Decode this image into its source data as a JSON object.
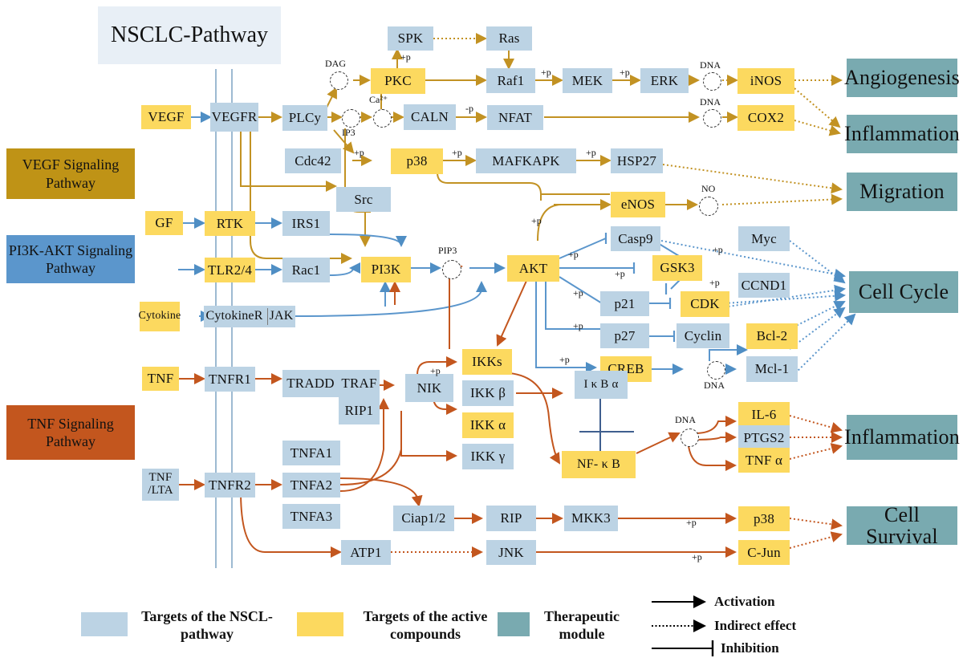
{
  "title": "NSCLC-Pathway",
  "colors": {
    "node_blue": "#bcd3e4",
    "node_yellow": "#fcd95f",
    "module_teal": "#79aab0",
    "vegf_pathway": "#bf9316",
    "pi3k_pathway": "#5b96cc",
    "tnf_pathway": "#c3561e",
    "title_bg": "#e8eff6",
    "edge_gold": "#c29223",
    "edge_blue": "#5b96cc",
    "edge_red": "#c3561e"
  },
  "pathway_labels": [
    {
      "id": "pw-vegf",
      "text": "VEGF Signaling Pathway",
      "color": "#bf9316"
    },
    {
      "id": "pw-pi3k",
      "text": "PI3K-AKT Signaling Pathway",
      "color": "#5b96cc"
    },
    {
      "id": "pw-tnf",
      "text": "TNF Signaling Pathway",
      "color": "#c3561e"
    }
  ],
  "nodes": {
    "vegf": "VEGF",
    "vegfr": "VEGFR",
    "plcy": "PLCy",
    "caln": "CALN",
    "nfat": "NFAT",
    "pkc": "PKC",
    "spk": "SPK",
    "ras": "Ras",
    "raf1": "Raf1",
    "mek": "MEK",
    "erk": "ERK",
    "inos": "iNOS",
    "cox2": "COX2",
    "cdc42": "Cdc42",
    "p38_top": "p38",
    "mafkapk": "MAFKAPK",
    "hsp27": "HSP27",
    "src": "Src",
    "enos": "eNOS",
    "gf": "GF",
    "rtk": "RTK",
    "irs1": "IRS1",
    "tlr24": "TLR2/4",
    "rac1": "Rac1",
    "pi3k": "PI3K",
    "akt": "AKT",
    "casp9": "Casp9",
    "myc": "Myc",
    "gsk3": "GSK3",
    "ccnd1": "CCND1",
    "p21": "p21",
    "cdk": "CDK",
    "p27": "p27",
    "cyclin": "Cyclin",
    "bcl2": "Bcl-2",
    "cytokine": "Cytokine",
    "cytokiner": "CytokineR",
    "jak": "JAK",
    "ikks": "IKKs",
    "creb": "CREB",
    "mcl1": "Mcl-1",
    "tnf": "TNF",
    "tnfr1": "TNFR1",
    "tradd": "TRADD",
    "traf": "TRAF",
    "rip1": "RIP1",
    "nik": "NIK",
    "ikk_beta": "IKK β",
    "ikk_alpha": "IKK α",
    "ikk_gamma": "IKK γ",
    "ikba": "I κ B α",
    "nfkb": "NF- κ B",
    "il6": "IL-6",
    "ptgs2": "PTGS2",
    "tnfa": "TNF α",
    "tnfa1": "TNFA1",
    "tnfa2": "TNFA2",
    "tnfa3": "TNFA3",
    "tnf_lta": "TNF /LTA",
    "tnfr2": "TNFR2",
    "ciap12": "Ciap1/2",
    "rip": "RIP",
    "mkk3": "MKK3",
    "p38_bot": "p38",
    "atp1": "ATP1",
    "jnk": "JNK",
    "cjun": "C-Jun"
  },
  "modules": {
    "angiogenesis": "Angiogenesis",
    "inflammation_top": "Inflammation",
    "migration": "Migration",
    "cell_cycle": "Cell Cycle",
    "inflammation_bottom": "Inflammation",
    "cell_survival": "Cell Survival"
  },
  "mediators": {
    "dag": "DAG",
    "ip3": "IP3",
    "ca2": "Ca²⁺",
    "dna1": "DNA",
    "dna2": "DNA",
    "no": "NO",
    "pip3": "PIP3",
    "dna3": "DNA",
    "dna4": "DNA"
  },
  "edge_labels": [
    {
      "id": "p-spk",
      "text": "+p"
    },
    {
      "id": "p-mek",
      "text": "+p"
    },
    {
      "id": "p-erk",
      "text": "+p"
    },
    {
      "id": "m-nfat",
      "text": "-p"
    },
    {
      "id": "p-cdc42",
      "text": "+p"
    },
    {
      "id": "p-p38",
      "text": "+p"
    },
    {
      "id": "p-mafk",
      "text": "+p"
    },
    {
      "id": "p-enos",
      "text": "+p"
    },
    {
      "id": "p-casp9",
      "text": "+p"
    },
    {
      "id": "p-gsk3",
      "text": "+p"
    },
    {
      "id": "p-p21",
      "text": "+p"
    },
    {
      "id": "p-p27",
      "text": "+p"
    },
    {
      "id": "p-myc",
      "text": "+p"
    },
    {
      "id": "p-ccnd1",
      "text": "+p"
    },
    {
      "id": "p-creb",
      "text": "+p"
    },
    {
      "id": "p-nik",
      "text": "+p"
    },
    {
      "id": "p-mkk3",
      "text": "+p"
    },
    {
      "id": "p-jnk",
      "text": "+p"
    }
  ],
  "legend": {
    "swatches": [
      {
        "id": "legend-blue",
        "color": "#bcd3e4",
        "label": "Targets of the NSCL-pathway"
      },
      {
        "id": "legend-yellow",
        "color": "#fcd95f",
        "label": "Targets of the active compounds"
      },
      {
        "id": "legend-teal",
        "color": "#79aab0",
        "label": "Therapeutic module"
      }
    ],
    "lines": [
      {
        "id": "legend-activation",
        "label": "Activation",
        "style": "solid-arrow"
      },
      {
        "id": "legend-indirect",
        "label": "Indirect effect",
        "style": "dotted-arrow"
      },
      {
        "id": "legend-inhibition",
        "label": "Inhibition",
        "style": "solid-bar"
      }
    ]
  }
}
